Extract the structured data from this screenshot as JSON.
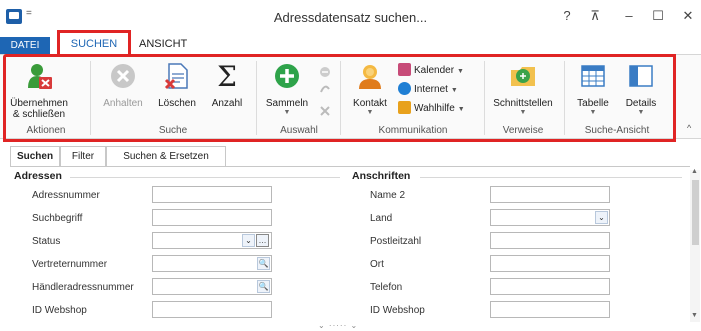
{
  "window": {
    "title": "Adressdatensatz suchen...",
    "qa_menu": "=",
    "help": "?",
    "ribbon_display": "⊼",
    "minimize": "–",
    "maximize": "☐",
    "close": "✕"
  },
  "menu_tabs": {
    "file": "DATEI",
    "search": "SUCHEN",
    "view": "ANSICHT"
  },
  "ribbon": {
    "take_close": {
      "line1": "Übernehmen",
      "line2": "& schließen"
    },
    "stop": "Anhalten",
    "delete": "Löschen",
    "count": "Anzahl",
    "collect": "Sammeln",
    "contact": "Kontakt",
    "calendar": "Kalender",
    "internet": "Internet",
    "dial": "Wahlhilfe",
    "interfaces": "Schnittstellen",
    "table": "Tabelle",
    "details": "Details",
    "groups": {
      "actions": "Aktionen",
      "search": "Suche",
      "selection": "Auswahl",
      "communication": "Kommunikation",
      "links": "Verweise",
      "search_view": "Suche-Ansicht"
    }
  },
  "subtabs": [
    "Suchen",
    "Filter",
    "Suchen & Ersetzen"
  ],
  "sections": {
    "addresses": "Adressen",
    "addresses_right": "Anschriften"
  },
  "left_fields": [
    "Adressnummer",
    "Suchbegriff",
    "Status",
    "Vertreternummer",
    "Händleradressnummer",
    "ID Webshop"
  ],
  "right_fields": [
    "Name 2",
    "Land",
    "Postleitzahl",
    "Ort",
    "Telefon",
    "ID Webshop"
  ],
  "bottom_grip": "⌄ ····· ⌄",
  "colors": {
    "accent": "#1e66b4",
    "highlight": "#e02424"
  }
}
